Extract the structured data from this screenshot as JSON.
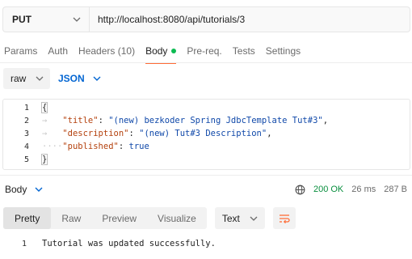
{
  "request": {
    "method": "PUT",
    "url": "http://localhost:8080/api/tutorials/3"
  },
  "tabs": [
    {
      "label": "Params"
    },
    {
      "label": "Auth"
    },
    {
      "label": "Headers (10)"
    },
    {
      "label": "Body",
      "active": true
    },
    {
      "label": "Pre-req."
    },
    {
      "label": "Tests"
    },
    {
      "label": "Settings"
    }
  ],
  "body_options": {
    "mode": "raw",
    "format": "JSON"
  },
  "editor": {
    "lines": [
      {
        "n": "1",
        "text": "{"
      },
      {
        "n": "2",
        "key": "\"title\"",
        "value": "\"(new) bezkoder Spring JdbcTemplate Tut#3\"",
        "trail": ","
      },
      {
        "n": "3",
        "key": "\"description\"",
        "value": "\"(new) Tut#3 Description\"",
        "trail": ","
      },
      {
        "n": "4",
        "key": "\"published\"",
        "value": "true",
        "trail": ""
      },
      {
        "n": "5",
        "text": "}"
      }
    ]
  },
  "response": {
    "title": "Body",
    "status": "200 OK",
    "time": "26 ms",
    "size": "287 B",
    "views": [
      "Pretty",
      "Raw",
      "Preview",
      "Visualize"
    ],
    "active_view": "Pretty",
    "text_format": "Text",
    "line_number": "1",
    "text": "Tutorial was updated successfully."
  },
  "colors": {
    "accent": "#ff6c37",
    "active_dot": "#0cbb52",
    "link_blue": "#0265d2",
    "status_ok": "#0a8f3f"
  }
}
